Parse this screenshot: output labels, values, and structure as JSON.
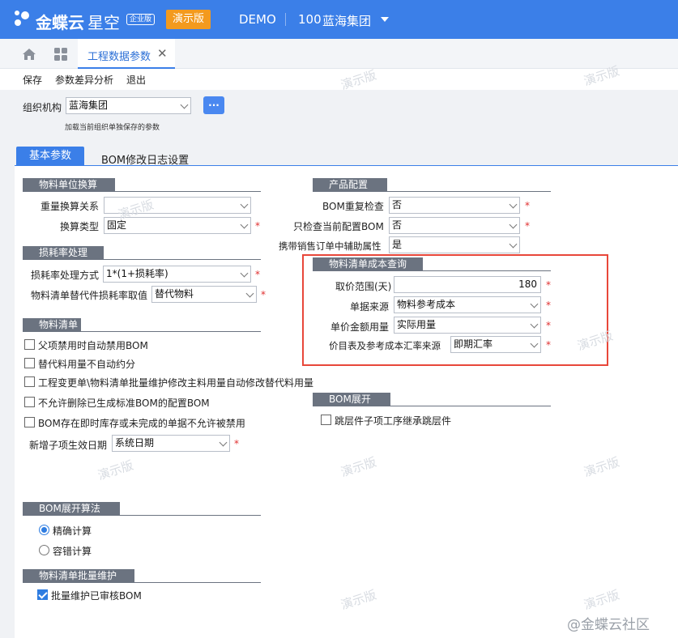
{
  "app": {
    "logo_text": "金蝶云",
    "product": "星空",
    "edition_badge": "企业版",
    "demo_badge": "演示版",
    "env": "DEMO",
    "org_code": "100",
    "org_name": "蓝海集团"
  },
  "tabs": {
    "active_tab": "工程数据参数"
  },
  "toolbar": {
    "save": "保存",
    "diff": "参数差异分析",
    "exit": "退出"
  },
  "org": {
    "label": "组织机构",
    "value": "蓝海集团",
    "more": "...",
    "hint": "加载当前组织单独保存的参数"
  },
  "page_tabs": [
    "基本参数",
    "BOM修改日志设置"
  ],
  "unit_conv": {
    "title": "物料单位换算",
    "weight_label": "重量换算关系",
    "weight_value": "",
    "type_label": "换算类型",
    "type_value": "固定"
  },
  "loss": {
    "title": "损耗率处理",
    "method_label": "损耗率处理方式",
    "method_value": "1*(1+损耗率)",
    "sub_label": "物料清单替代件损耗率取值",
    "sub_value": "替代物料"
  },
  "bom": {
    "title": "物料清单",
    "items": [
      {
        "label": "父项禁用时自动禁用BOM",
        "checked": false
      },
      {
        "label": "替代料用量不自动约分",
        "checked": false
      },
      {
        "label": "工程变更单\\物料清单批量维护修改主料用量自动修改替代料用量",
        "checked": false
      },
      {
        "label": "不允许删除已生成标准BOM的配置BOM",
        "checked": false
      },
      {
        "label": "BOM存在即时库存或未完成的单据不允许被禁用",
        "checked": false
      }
    ],
    "date_label": "新增子项生效日期",
    "date_value": "系统日期"
  },
  "algo": {
    "title": "BOM展开算法",
    "options": [
      {
        "label": "精确计算",
        "selected": true
      },
      {
        "label": "容错计算",
        "selected": false
      }
    ]
  },
  "batch": {
    "title": "物料清单批量维护",
    "item": {
      "label": "批量维护已审核BOM",
      "checked": true
    }
  },
  "product_cfg": {
    "title": "产品配置",
    "dup_label": "BOM重复检查",
    "dup_value": "否",
    "only_label": "只检查当前配置BOM",
    "only_value": "否",
    "aux_label": "携带销售订单中辅助属性",
    "aux_value": "是"
  },
  "cost_query": {
    "title": "物料清单成本查询",
    "range_label": "取价范围(天)",
    "range_value": "180",
    "source_label": "单据来源",
    "source_value": "物料参考成本",
    "qty_label": "单价金额用量",
    "qty_value": "实际用量",
    "rate_label": "价目表及参考成本汇率来源",
    "rate_value": "即期汇率",
    "highlight_color": "#e8473a"
  },
  "expand": {
    "title": "BOM展开",
    "item": {
      "label": "跳层件子项工序继承跳层件",
      "checked": false
    }
  },
  "watermark": "演示版",
  "footer_brand": "@金蝶云社区",
  "colors": {
    "brand": "#3b7fe8",
    "demo_badge": "#f39a1e",
    "group_header": "#6b7380"
  }
}
